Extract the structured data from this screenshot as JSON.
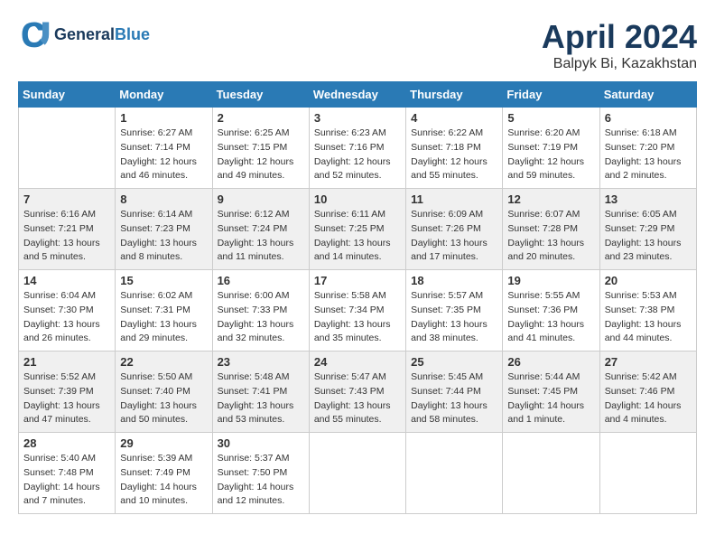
{
  "header": {
    "logo_line1": "General",
    "logo_line2": "Blue",
    "month_title": "April 2024",
    "location": "Balpyk Bi, Kazakhstan"
  },
  "weekdays": [
    "Sunday",
    "Monday",
    "Tuesday",
    "Wednesday",
    "Thursday",
    "Friday",
    "Saturday"
  ],
  "weeks": [
    [
      {
        "day": "",
        "sunrise": "",
        "sunset": "",
        "daylight": ""
      },
      {
        "day": "1",
        "sunrise": "Sunrise: 6:27 AM",
        "sunset": "Sunset: 7:14 PM",
        "daylight": "Daylight: 12 hours and 46 minutes."
      },
      {
        "day": "2",
        "sunrise": "Sunrise: 6:25 AM",
        "sunset": "Sunset: 7:15 PM",
        "daylight": "Daylight: 12 hours and 49 minutes."
      },
      {
        "day": "3",
        "sunrise": "Sunrise: 6:23 AM",
        "sunset": "Sunset: 7:16 PM",
        "daylight": "Daylight: 12 hours and 52 minutes."
      },
      {
        "day": "4",
        "sunrise": "Sunrise: 6:22 AM",
        "sunset": "Sunset: 7:18 PM",
        "daylight": "Daylight: 12 hours and 55 minutes."
      },
      {
        "day": "5",
        "sunrise": "Sunrise: 6:20 AM",
        "sunset": "Sunset: 7:19 PM",
        "daylight": "Daylight: 12 hours and 59 minutes."
      },
      {
        "day": "6",
        "sunrise": "Sunrise: 6:18 AM",
        "sunset": "Sunset: 7:20 PM",
        "daylight": "Daylight: 13 hours and 2 minutes."
      }
    ],
    [
      {
        "day": "7",
        "sunrise": "Sunrise: 6:16 AM",
        "sunset": "Sunset: 7:21 PM",
        "daylight": "Daylight: 13 hours and 5 minutes."
      },
      {
        "day": "8",
        "sunrise": "Sunrise: 6:14 AM",
        "sunset": "Sunset: 7:23 PM",
        "daylight": "Daylight: 13 hours and 8 minutes."
      },
      {
        "day": "9",
        "sunrise": "Sunrise: 6:12 AM",
        "sunset": "Sunset: 7:24 PM",
        "daylight": "Daylight: 13 hours and 11 minutes."
      },
      {
        "day": "10",
        "sunrise": "Sunrise: 6:11 AM",
        "sunset": "Sunset: 7:25 PM",
        "daylight": "Daylight: 13 hours and 14 minutes."
      },
      {
        "day": "11",
        "sunrise": "Sunrise: 6:09 AM",
        "sunset": "Sunset: 7:26 PM",
        "daylight": "Daylight: 13 hours and 17 minutes."
      },
      {
        "day": "12",
        "sunrise": "Sunrise: 6:07 AM",
        "sunset": "Sunset: 7:28 PM",
        "daylight": "Daylight: 13 hours and 20 minutes."
      },
      {
        "day": "13",
        "sunrise": "Sunrise: 6:05 AM",
        "sunset": "Sunset: 7:29 PM",
        "daylight": "Daylight: 13 hours and 23 minutes."
      }
    ],
    [
      {
        "day": "14",
        "sunrise": "Sunrise: 6:04 AM",
        "sunset": "Sunset: 7:30 PM",
        "daylight": "Daylight: 13 hours and 26 minutes."
      },
      {
        "day": "15",
        "sunrise": "Sunrise: 6:02 AM",
        "sunset": "Sunset: 7:31 PM",
        "daylight": "Daylight: 13 hours and 29 minutes."
      },
      {
        "day": "16",
        "sunrise": "Sunrise: 6:00 AM",
        "sunset": "Sunset: 7:33 PM",
        "daylight": "Daylight: 13 hours and 32 minutes."
      },
      {
        "day": "17",
        "sunrise": "Sunrise: 5:58 AM",
        "sunset": "Sunset: 7:34 PM",
        "daylight": "Daylight: 13 hours and 35 minutes."
      },
      {
        "day": "18",
        "sunrise": "Sunrise: 5:57 AM",
        "sunset": "Sunset: 7:35 PM",
        "daylight": "Daylight: 13 hours and 38 minutes."
      },
      {
        "day": "19",
        "sunrise": "Sunrise: 5:55 AM",
        "sunset": "Sunset: 7:36 PM",
        "daylight": "Daylight: 13 hours and 41 minutes."
      },
      {
        "day": "20",
        "sunrise": "Sunrise: 5:53 AM",
        "sunset": "Sunset: 7:38 PM",
        "daylight": "Daylight: 13 hours and 44 minutes."
      }
    ],
    [
      {
        "day": "21",
        "sunrise": "Sunrise: 5:52 AM",
        "sunset": "Sunset: 7:39 PM",
        "daylight": "Daylight: 13 hours and 47 minutes."
      },
      {
        "day": "22",
        "sunrise": "Sunrise: 5:50 AM",
        "sunset": "Sunset: 7:40 PM",
        "daylight": "Daylight: 13 hours and 50 minutes."
      },
      {
        "day": "23",
        "sunrise": "Sunrise: 5:48 AM",
        "sunset": "Sunset: 7:41 PM",
        "daylight": "Daylight: 13 hours and 53 minutes."
      },
      {
        "day": "24",
        "sunrise": "Sunrise: 5:47 AM",
        "sunset": "Sunset: 7:43 PM",
        "daylight": "Daylight: 13 hours and 55 minutes."
      },
      {
        "day": "25",
        "sunrise": "Sunrise: 5:45 AM",
        "sunset": "Sunset: 7:44 PM",
        "daylight": "Daylight: 13 hours and 58 minutes."
      },
      {
        "day": "26",
        "sunrise": "Sunrise: 5:44 AM",
        "sunset": "Sunset: 7:45 PM",
        "daylight": "Daylight: 14 hours and 1 minute."
      },
      {
        "day": "27",
        "sunrise": "Sunrise: 5:42 AM",
        "sunset": "Sunset: 7:46 PM",
        "daylight": "Daylight: 14 hours and 4 minutes."
      }
    ],
    [
      {
        "day": "28",
        "sunrise": "Sunrise: 5:40 AM",
        "sunset": "Sunset: 7:48 PM",
        "daylight": "Daylight: 14 hours and 7 minutes."
      },
      {
        "day": "29",
        "sunrise": "Sunrise: 5:39 AM",
        "sunset": "Sunset: 7:49 PM",
        "daylight": "Daylight: 14 hours and 10 minutes."
      },
      {
        "day": "30",
        "sunrise": "Sunrise: 5:37 AM",
        "sunset": "Sunset: 7:50 PM",
        "daylight": "Daylight: 14 hours and 12 minutes."
      },
      {
        "day": "",
        "sunrise": "",
        "sunset": "",
        "daylight": ""
      },
      {
        "day": "",
        "sunrise": "",
        "sunset": "",
        "daylight": ""
      },
      {
        "day": "",
        "sunrise": "",
        "sunset": "",
        "daylight": ""
      },
      {
        "day": "",
        "sunrise": "",
        "sunset": "",
        "daylight": ""
      }
    ]
  ]
}
